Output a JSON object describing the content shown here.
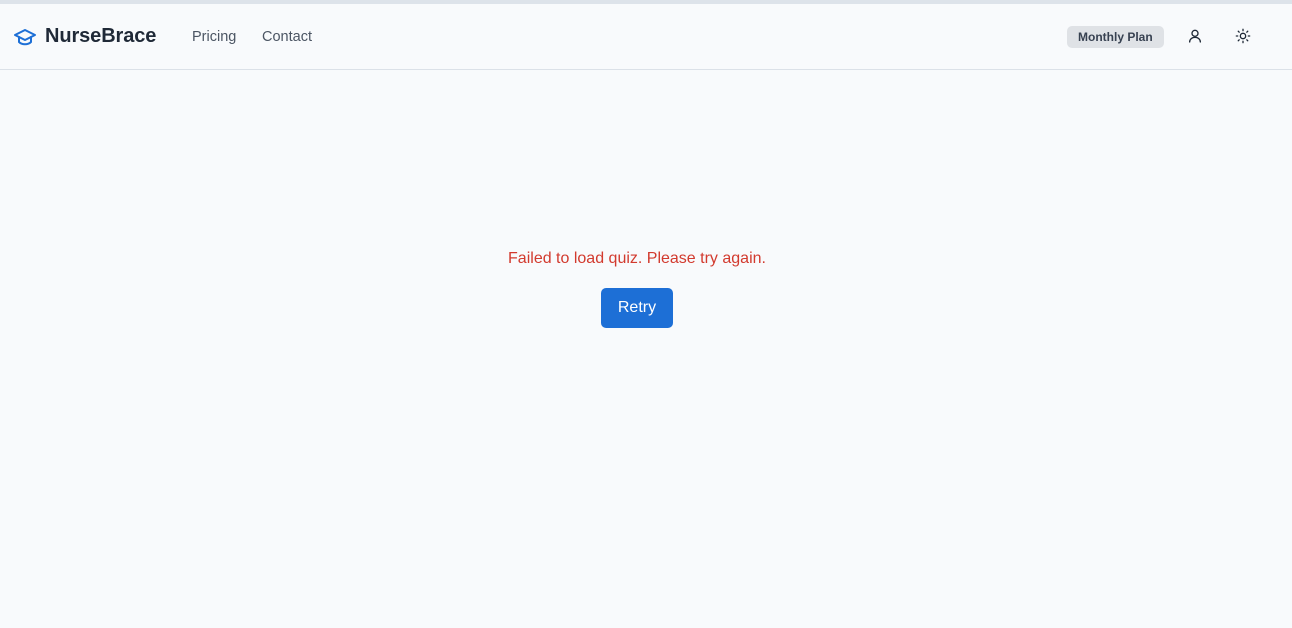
{
  "header": {
    "brand_name": "NurseBrace",
    "brand_icon": "graduation-cap-icon",
    "nav": [
      {
        "label": "Pricing"
      },
      {
        "label": "Contact"
      }
    ],
    "plan_badge": "Monthly Plan",
    "user_icon": "user-icon",
    "theme_icon": "sun-icon"
  },
  "main": {
    "error_message": "Failed to load quiz. Please try again.",
    "retry_label": "Retry"
  },
  "colors": {
    "primary": "#1d6fd6",
    "error": "#d23a2e",
    "background": "#f8fafc",
    "badge_bg": "#dfe2e6",
    "brand_text": "#1f2937"
  }
}
